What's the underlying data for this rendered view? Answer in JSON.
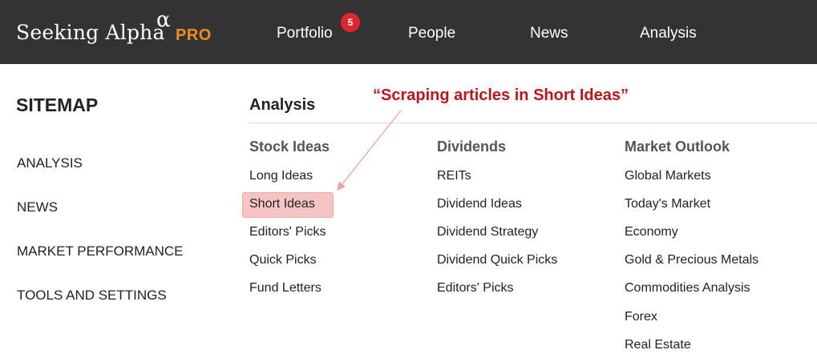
{
  "brand": {
    "name": "Seeking Alpha",
    "alpha_glyph": "α",
    "tier": "PRO"
  },
  "nav": {
    "items": [
      {
        "label": "Portfolio",
        "badge": "5"
      },
      {
        "label": "People"
      },
      {
        "label": "News"
      },
      {
        "label": "Analysis"
      }
    ]
  },
  "sidebar": {
    "title": "SITEMAP",
    "items": [
      "ANALYSIS",
      "NEWS",
      "MARKET PERFORMANCE",
      "TOOLS AND SETTINGS"
    ]
  },
  "main": {
    "section_title": "Analysis",
    "annotation": "“Scraping articles in Short Ideas”",
    "columns": [
      {
        "header": "Stock Ideas",
        "links": [
          "Long Ideas",
          "Short Ideas",
          "Editors' Picks",
          "Quick Picks",
          "Fund Letters"
        ]
      },
      {
        "header": "Dividends",
        "links": [
          "REITs",
          "Dividend Ideas",
          "Dividend Strategy",
          "Dividend Quick Picks",
          "Editors' Picks"
        ]
      },
      {
        "header": "Market Outlook",
        "links": [
          "Global Markets",
          "Today's Market",
          "Economy",
          "Gold & Precious Metals",
          "Commodities Analysis",
          "Forex",
          "Real Estate"
        ]
      }
    ],
    "highlighted_link": "Short Ideas"
  },
  "colors": {
    "topbar": "#333333",
    "pro_accent": "#f28c1f",
    "badge": "#e0262d",
    "annotation": "#c0141b",
    "highlight": "#f6c4c4"
  }
}
